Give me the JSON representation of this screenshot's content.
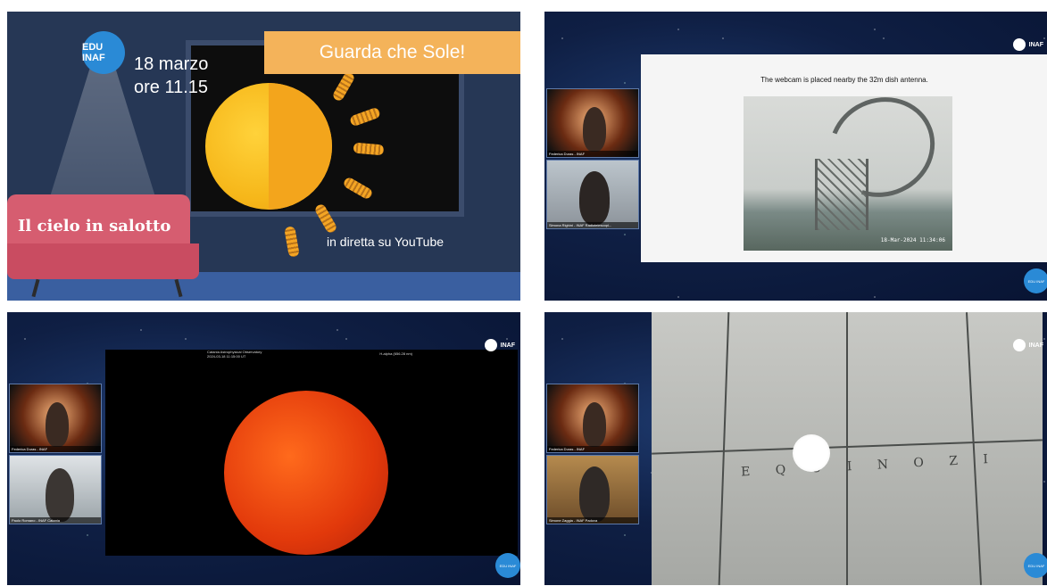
{
  "panel1": {
    "badge": "EDU INAF",
    "date_line1": "18 marzo",
    "date_line2": "ore 11.15",
    "banner": "Guarda che Sole!",
    "sofa_text": "Il cielo in salotto",
    "live": "in diretta su YouTube"
  },
  "panel2": {
    "logo": "INAF",
    "caption": "The webcam is placed nearby the 32m dish antenna.",
    "timestamp": "18-Mar-2024 11:34:06",
    "tiles": [
      {
        "label": "Federica Duras - INAF"
      },
      {
        "label": "Simona Righini - INAF Radiotelescopi..."
      }
    ],
    "corner_badge": "EDU INAF"
  },
  "panel3": {
    "logo": "INAF",
    "observatory": "Catania Astrophysical Observatory",
    "obs_time": "2024-03-18 11:15:00 UT",
    "filter": "H-alpha (656.28 nm)",
    "tiles": [
      {
        "label": "Federica Duras - INAF"
      },
      {
        "label": "Paolo Romano - INAF Catania"
      }
    ],
    "corner_badge": "EDU INAF"
  },
  "panel4": {
    "logo": "INAF",
    "meridian_text": "E Q U I N O Z I",
    "tiles": [
      {
        "label": "Federica Duras - INAF"
      },
      {
        "label": "Simone Zaggia - INAF Padova"
      }
    ],
    "corner_badge": "EDU INAF"
  }
}
